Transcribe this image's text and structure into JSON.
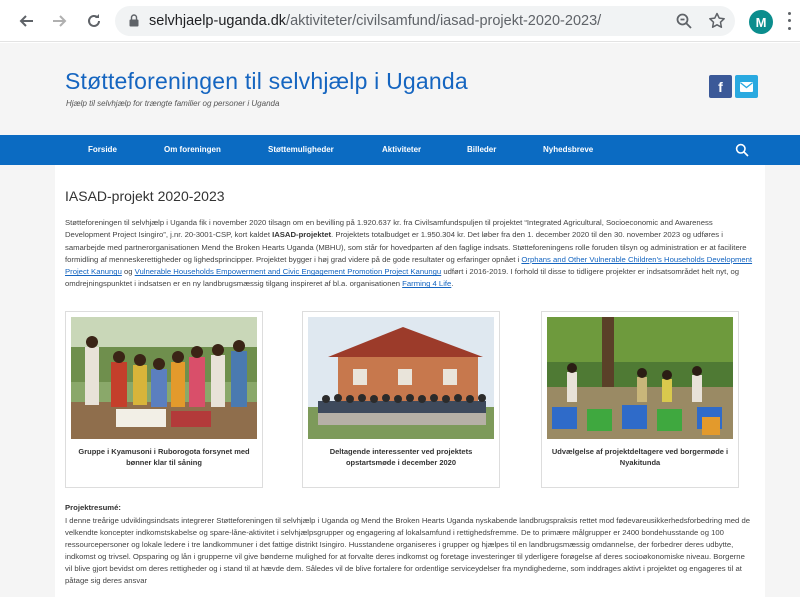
{
  "browser": {
    "url_host": "selvhjaelp-uganda.dk",
    "url_path": "/aktiviteter/civilsamfund/iasad-projekt-2020-2023/",
    "avatar_letter": "M"
  },
  "site": {
    "title": "Støtteforeningen til selvhjælp i Uganda",
    "tagline": "Hjælp til selvhjælp for trængte familier og personer i Uganda",
    "social": {
      "facebook": "f"
    }
  },
  "menu": {
    "items": [
      "Forside",
      "Om foreningen",
      "Støttemuligheder",
      "Aktiviteter",
      "Billeder",
      "Nyhedsbreve"
    ]
  },
  "article": {
    "title": "IASAD-projekt 2020-2023",
    "intro": {
      "t1": "Støtteforeningen til selvhjælp i Uganda fik i november 2020 tilsagn om en bevilling på 1.920.637 kr. fra Civilsamfundspuljen til projektet “Integrated Agricultural, Socioeconomic and Awareness Development Project Isingiro”, j.nr. 20-3001-CSP, kort kaldet ",
      "t1_bold": "IASAD-projektet",
      "t2": ". Projektets totalbudget er 1.950.304 kr. Det løber fra den 1. december 2020 til den 30. november 2023 og udføres i samarbejde med partnerorganisationen Mend the Broken Hearts Uganda (MBHU), som står for hovedparten af den faglige indsats. Støtteforeningens rolle foruden tilsyn og administration er at facilitere formidling af menneskerettigheder og lighedsprincipper. Projektet bygger i høj grad videre på de gode resultater og erfaringer opnået i ",
      "link1": "Orphans and Other Vulnerable Children's Households Development Project Kanungu",
      "t3": " og ",
      "link2": "Vulnerable Households Empowerment and Civic Engagement Promotion Project Kanungu",
      "t4": " udført i 2016-2019. I forhold til disse to tidligere projekter er indsatsområdet helt nyt, og omdrejningspunktet i indsatsen er en ny landbrugsmæssig tilgang inspireret af bl.a. organisationen ",
      "link3": "Farming 4 Life",
      "t5": "."
    },
    "photos": [
      {
        "caption": "Gruppe i Kyamusoni i Ruborogota forsynet med bønner klar til såning"
      },
      {
        "caption": "Deltagende interessenter ved projektets opstartsmøde i december 2020"
      },
      {
        "caption": "Udvælgelse af projektdeltagere ved borgermøde i Nyakitunda"
      }
    ],
    "resume_heading": "Projektresumé:",
    "resume": "I denne treårige udviklingsindsats integrerer Støtteforeningen til selvhjælp i Uganda og Mend the Broken Hearts Uganda nyskabende landbrugspraksis rettet mod fødevareusikkerhedsforbedring med de velkendte koncepter indkomstskabelse og spare-låne-aktivitet i selvhjælpsgrupper og engagering af lokalsamfund i rettighedsfremme. De to primære målgrupper er 2400 bondehusstande og 100 ressourcepersoner og lokale ledere i tre landkommuner i det fattige distrikt Isingiro. Husstandene organiseres i grupper og hjælpes til en landbrugsmæssig omdannelse, der forbedrer deres udbytte, indkomst og trivsel. Opsparing og lån i grupperne vil give bønderne mulighed for at forvalte deres indkomst og foretage investeringer til yderligere forøgelse af deres socioøkonomiske niveau. Borgerne vil blive gjort bevidst om deres rettigheder og i stand til at hævde dem. Således vil de blive fortalere for ordentlige serviceydelser fra myndighederne, som inddrages aktivt i projektet og engageres til at påtage sig deres ansvar"
  },
  "colors": {
    "brand_blue": "#1565c0",
    "menu_blue": "#0b6bc2",
    "facebook": "#3b5998",
    "mail": "#29a9e0"
  }
}
